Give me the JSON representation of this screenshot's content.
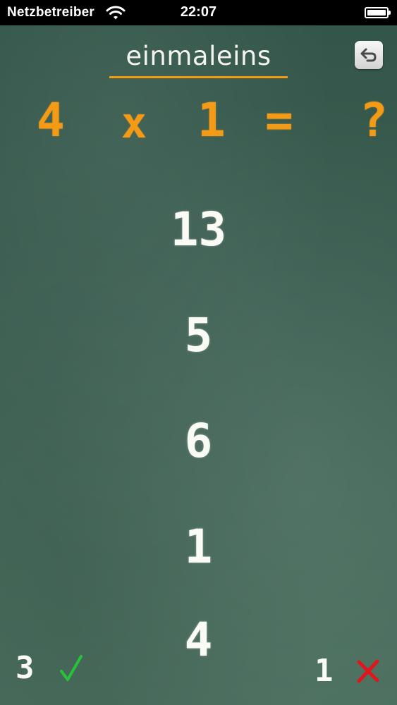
{
  "status_bar": {
    "carrier": "Netzbetreiber",
    "time": "22:07",
    "wifi_icon": "wifi-icon",
    "battery_icon": "battery-icon"
  },
  "header": {
    "title": "einmaleins",
    "back_icon": "undo-arrow-icon"
  },
  "question": {
    "a": "4",
    "operator": "x",
    "b": "1",
    "equals": "=",
    "unknown": "?"
  },
  "answers": [
    "13",
    "5",
    "6",
    "1",
    "4"
  ],
  "score": {
    "correct": "3",
    "correct_icon": "check-icon",
    "wrong": "1",
    "wrong_icon": "cross-icon"
  },
  "colors": {
    "chalkboard": "#3b5e51",
    "accent_orange": "#f39a16",
    "chalk_white": "#fbfbf6",
    "check_green": "#27c23a",
    "cross_red": "#e0161c"
  }
}
